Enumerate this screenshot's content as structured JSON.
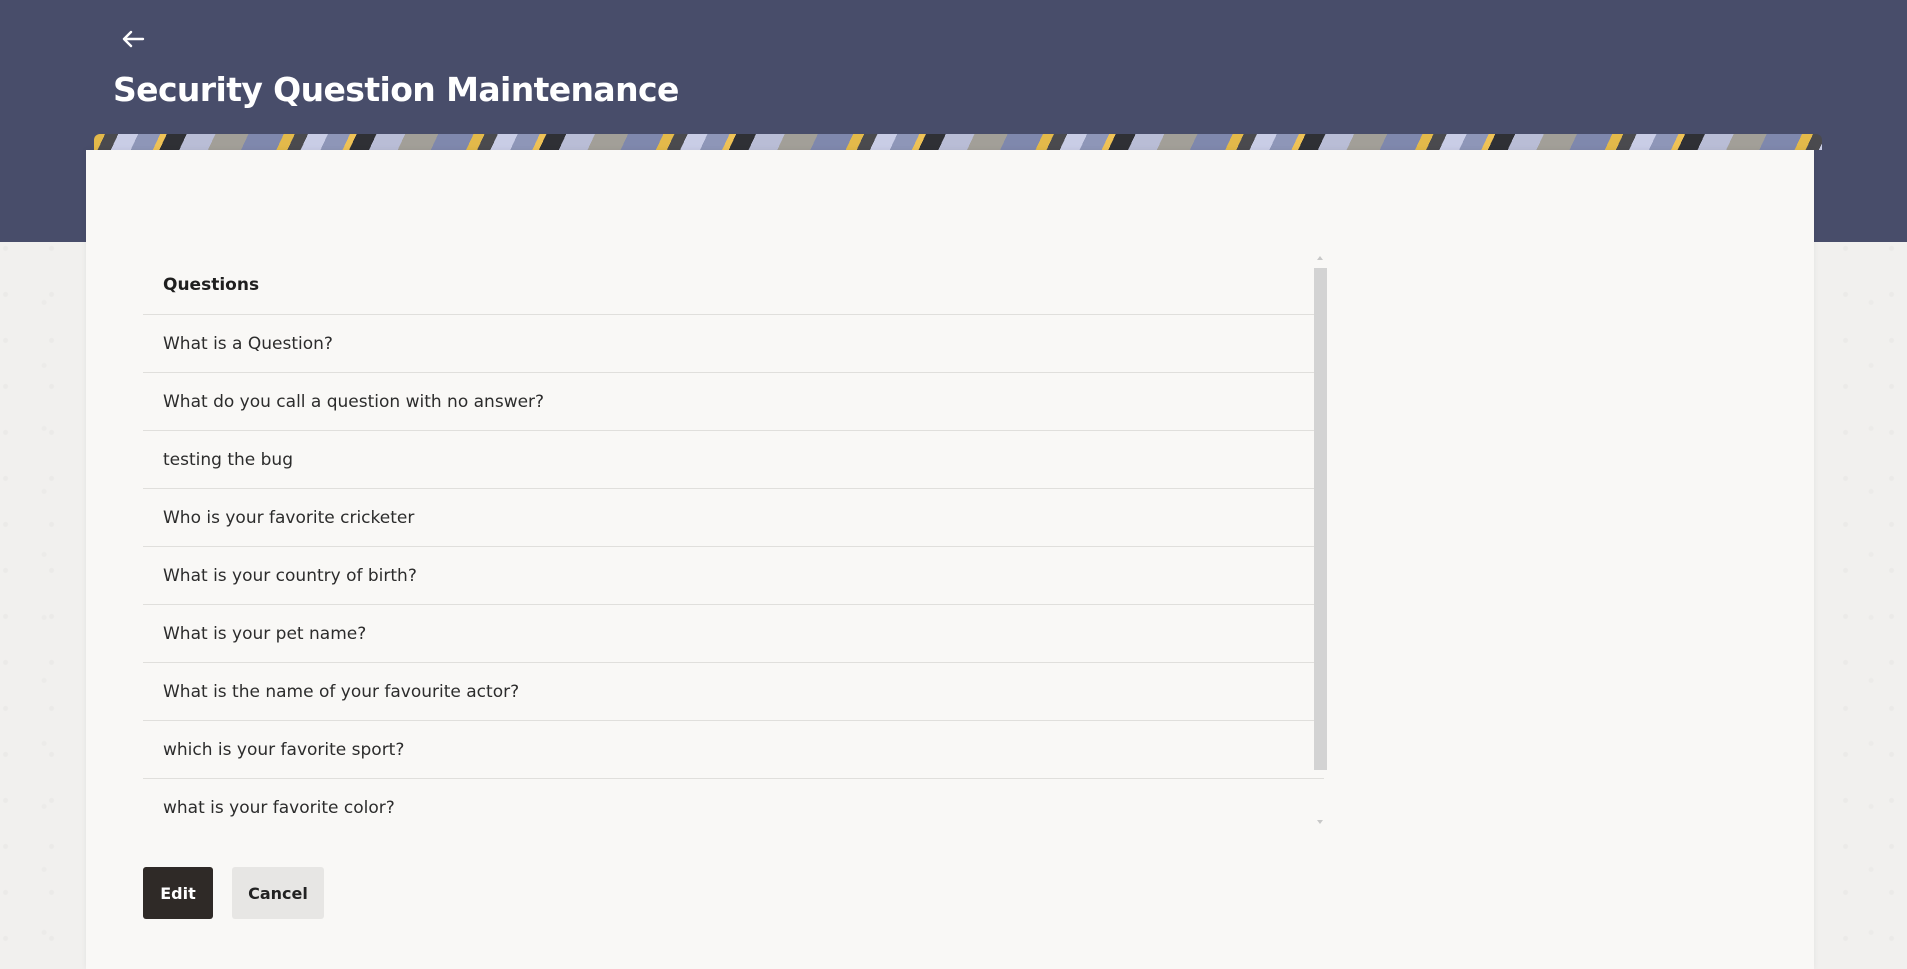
{
  "header": {
    "back_icon": "arrow-left-icon",
    "title": "Security Question Maintenance"
  },
  "questions": {
    "header": "Questions",
    "items": [
      "What is a Question?",
      "What do you call a question with no answer?",
      "testing the bug",
      "Who is your favorite cricketer",
      "What is your country of birth?",
      "What is your pet name?",
      "What is the name of your favourite actor?",
      "which is your favorite sport?",
      "what is your favorite color?"
    ]
  },
  "actions": {
    "edit_label": "Edit",
    "cancel_label": "Cancel"
  },
  "colors": {
    "header_bg": "#484d6a",
    "card_bg": "#f9f8f6",
    "primary_button": "#2f2a27",
    "secondary_button": "#e7e6e4"
  }
}
